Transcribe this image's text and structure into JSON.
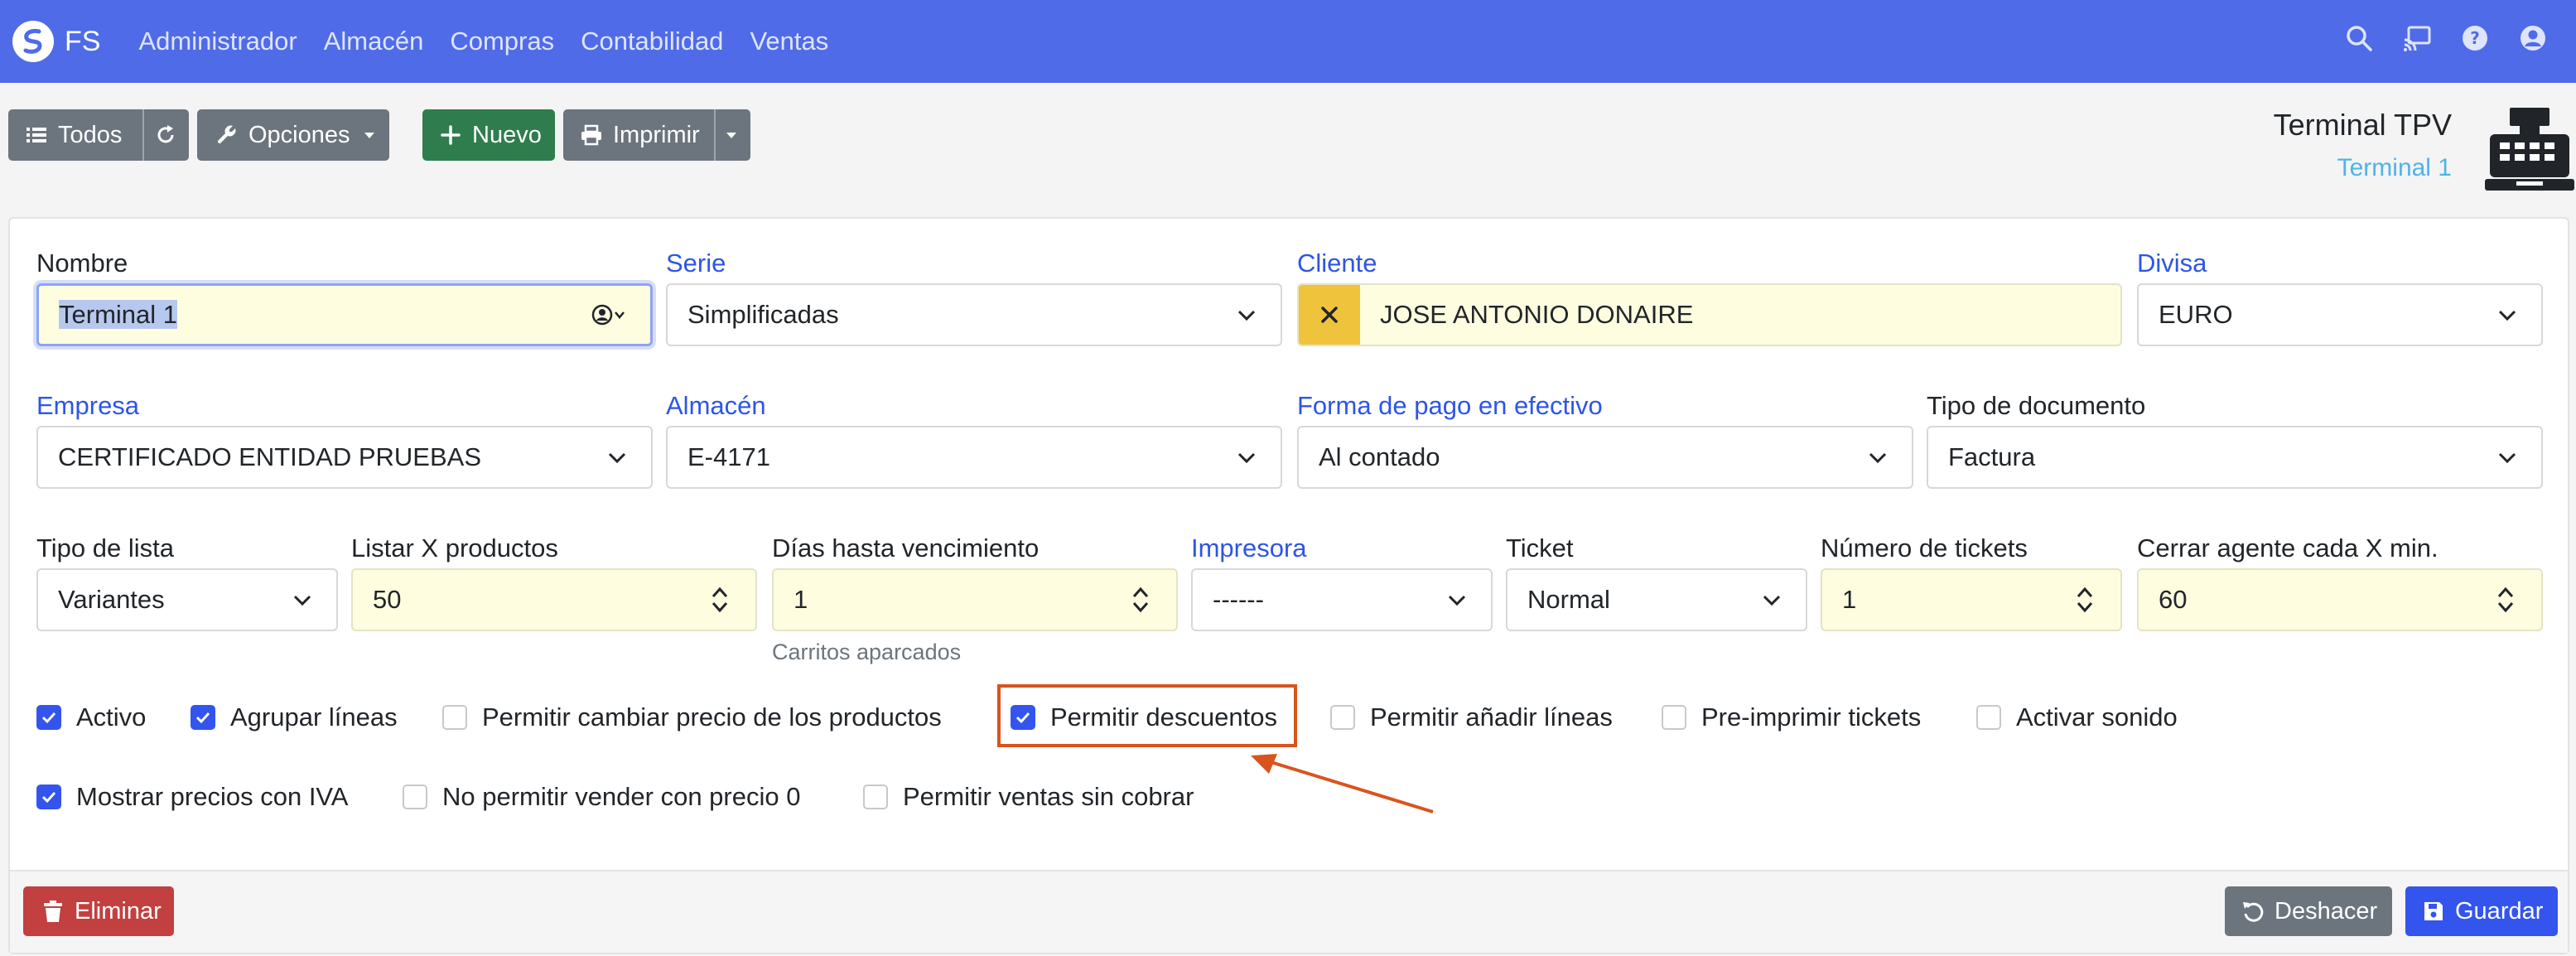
{
  "navbar": {
    "brand": "FS",
    "menu": [
      "Administrador",
      "Almacén",
      "Compras",
      "Contabilidad",
      "Ventas"
    ]
  },
  "toolbar": {
    "all_label": "Todos",
    "options_label": "Opciones",
    "new_label": "Nuevo",
    "print_label": "Imprimir"
  },
  "header": {
    "title": "Terminal TPV",
    "subtitle": "Terminal 1"
  },
  "form": {
    "nombre": {
      "label": "Nombre",
      "value": "Terminal 1"
    },
    "serie": {
      "label": "Serie",
      "value": "Simplificadas"
    },
    "cliente": {
      "label": "Cliente",
      "value": "JOSE ANTONIO DONAIRE"
    },
    "divisa": {
      "label": "Divisa",
      "value": "EURO"
    },
    "empresa": {
      "label": "Empresa",
      "value": "CERTIFICADO ENTIDAD PRUEBAS"
    },
    "almacen": {
      "label": "Almacén",
      "value": "E-4171"
    },
    "forma_pago": {
      "label": "Forma de pago en efectivo",
      "value": "Al contado"
    },
    "tipo_documento": {
      "label": "Tipo de documento",
      "value": "Factura"
    },
    "tipo_lista": {
      "label": "Tipo de lista",
      "value": "Variantes"
    },
    "listar_productos": {
      "label": "Listar X productos",
      "value": "50"
    },
    "dias_vencimiento": {
      "label": "Días hasta vencimiento",
      "value": "1",
      "help": "Carritos aparcados"
    },
    "impresora": {
      "label": "Impresora",
      "value": "------"
    },
    "ticket": {
      "label": "Ticket",
      "value": "Normal"
    },
    "numero_tickets": {
      "label": "Número de tickets",
      "value": "1"
    },
    "cerrar_agente": {
      "label": "Cerrar agente cada X min.",
      "value": "60"
    }
  },
  "checkboxes": [
    {
      "label": "Activo",
      "checked": true
    },
    {
      "label": "Agrupar líneas",
      "checked": true
    },
    {
      "label": "Permitir cambiar precio de los productos",
      "checked": false
    },
    {
      "label": "Permitir descuentos",
      "checked": true
    },
    {
      "label": "Permitir añadir líneas",
      "checked": false
    },
    {
      "label": "Pre-imprimir tickets",
      "checked": false
    },
    {
      "label": "Activar sonido",
      "checked": false
    },
    {
      "label": "Mostrar precios con IVA",
      "checked": true
    },
    {
      "label": "No permitir vender con precio 0",
      "checked": false
    },
    {
      "label": "Permitir ventas sin cobrar",
      "checked": false
    }
  ],
  "footer": {
    "delete_label": "Eliminar",
    "undo_label": "Deshacer",
    "save_label": "Guardar"
  },
  "colors": {
    "navbar": "#4f6be8",
    "primary": "#3355ee",
    "success": "#2f7d4d",
    "danger": "#c24040",
    "highlight": "#d9531e"
  }
}
